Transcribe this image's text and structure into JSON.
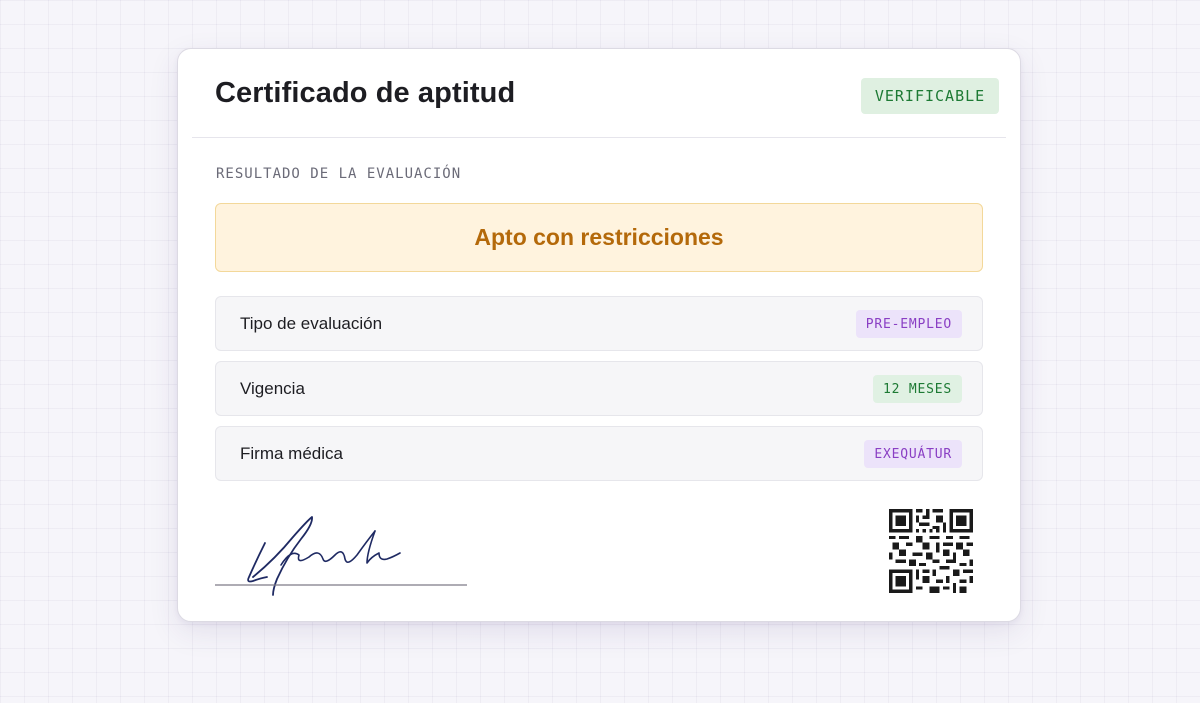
{
  "certificate": {
    "title": "Certificado de aptitud",
    "badge": "VERIFICABLE",
    "section_label": "RESULTADO DE LA EVALUACIÓN",
    "result": "Apto con restricciones",
    "rows": [
      {
        "label": "Tipo de evaluación",
        "value": "PRE-EMPLEO",
        "tone": "purple"
      },
      {
        "label": "Vigencia",
        "value": "12 MESES",
        "tone": "green"
      },
      {
        "label": "Firma médica",
        "value": "EXEQUÁTUR",
        "tone": "purple"
      }
    ]
  },
  "icons": {
    "signature": "handwritten-signature",
    "qr": "qr-code"
  },
  "colors": {
    "verify_green": "#1d7a34",
    "result_amber": "#b4690a",
    "tag_purple": "#8a3fc4",
    "signature_ink": "#1f2a63"
  }
}
